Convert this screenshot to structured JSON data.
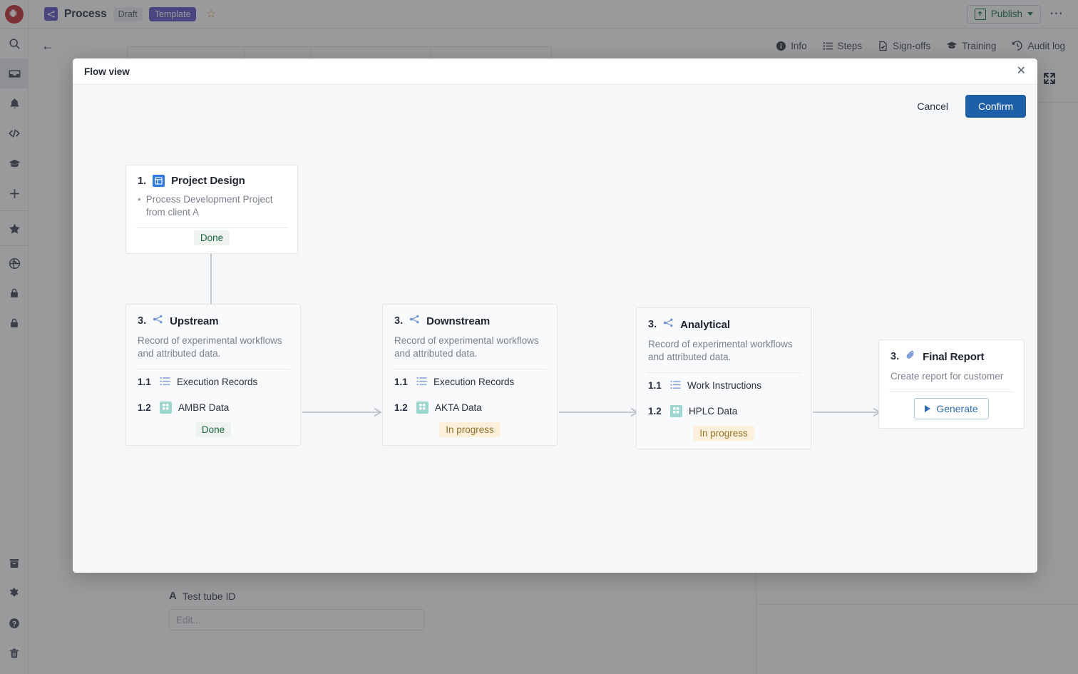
{
  "topbar": {
    "logo_icon": "lobster-logo-icon",
    "doc_type_icon": "flow-node-icon",
    "title": "Process",
    "draft_chip": "Draft",
    "template_chip": "Template",
    "star_icon": "star-outline-icon",
    "publish_label": "Publish",
    "publish_icon": "publish-upload-icon",
    "publish_caret_icon": "chevron-down-icon",
    "more_icon": "ellipsis-icon",
    "publish_color": "#0b6b3a",
    "template_chip_color": "#5b4bc4"
  },
  "rail": {
    "items": [
      {
        "icon": "search-icon",
        "active": false
      },
      {
        "icon": "inbox-icon",
        "active": true
      },
      {
        "icon": "bell-icon",
        "active": false
      },
      {
        "icon": "code-icon",
        "active": false
      },
      {
        "icon": "graduation-cap-icon",
        "active": false
      },
      {
        "icon": "plus-icon",
        "active": false
      },
      {
        "icon": "star-icon",
        "active": false
      },
      {
        "icon": "globe-icon",
        "active": false
      },
      {
        "icon": "lock-icon",
        "active": false
      },
      {
        "icon": "lock-closed-icon",
        "active": false
      }
    ],
    "bottom_items": [
      {
        "icon": "archive-icon"
      },
      {
        "icon": "gear-icon"
      },
      {
        "icon": "help-circle-icon"
      },
      {
        "icon": "trash-icon"
      }
    ]
  },
  "subheader": {
    "back_icon": "back-arrow-icon",
    "tabs": [
      {
        "icon": "info-icon",
        "label": "Info"
      },
      {
        "icon": "steps-list-icon",
        "label": "Steps"
      },
      {
        "icon": "sign-offs-doc-icon",
        "label": "Sign-offs"
      },
      {
        "icon": "training-cap-icon",
        "label": "Training"
      },
      {
        "icon": "audit-log-clock-icon",
        "label": "Audit log"
      }
    ]
  },
  "background_field": {
    "glyph": "A",
    "label": "Test tube ID",
    "input_placeholder": "Edit..."
  },
  "modal": {
    "title": "Flow view",
    "close_icon": "close-icon",
    "expand_icon": "expand-fullscreen-icon",
    "cancel_label": "Cancel",
    "confirm_label": "Confirm",
    "confirm_color": "#1d5fa8"
  },
  "flow": {
    "cards": [
      {
        "id": "project-design",
        "num": "1.",
        "icon": "layout-panel-icon",
        "icon_style": "blue-box",
        "title": "Project Design",
        "desc": "Process Development Project from client A",
        "desc_style": "bullet",
        "subitems": [],
        "badge": {
          "label": "Done",
          "style": "done"
        }
      },
      {
        "id": "upstream",
        "num": "3.",
        "icon": "flow-node-icon",
        "icon_style": "plain-blue",
        "title": "Upstream",
        "desc": "Record of experimental workflows and attributed data.",
        "desc_style": "plain",
        "subitems": [
          {
            "num": "1.1",
            "icon": "list-checklist-icon",
            "icon_style": "plain-blue",
            "label": "Execution Records"
          },
          {
            "num": "1.2",
            "icon": "table-grid-icon",
            "icon_style": "teal-box",
            "label": "AMBR Data"
          }
        ],
        "badge": {
          "label": "Done",
          "style": "done"
        }
      },
      {
        "id": "downstream",
        "num": "3.",
        "icon": "flow-node-icon",
        "icon_style": "plain-blue",
        "title": "Downstream",
        "desc": "Record of experimental workflows and attributed data.",
        "desc_style": "plain",
        "subitems": [
          {
            "num": "1.1",
            "icon": "list-checklist-icon",
            "icon_style": "plain-blue",
            "label": "Execution Records"
          },
          {
            "num": "1.2",
            "icon": "table-grid-icon",
            "icon_style": "teal-box",
            "label": "AKTA Data"
          }
        ],
        "badge": {
          "label": "In progress",
          "style": "progress"
        }
      },
      {
        "id": "analytical",
        "num": "3.",
        "icon": "flow-node-icon",
        "icon_style": "plain-blue",
        "title": "Analytical",
        "desc": "Record of experimental workflows and attributed data.",
        "desc_style": "plain",
        "subitems": [
          {
            "num": "1.1",
            "icon": "list-checklist-icon",
            "icon_style": "plain-blue",
            "label": "Work Instructions"
          },
          {
            "num": "1.2",
            "icon": "table-grid-icon",
            "icon_style": "teal-box",
            "label": "HPLC Data"
          }
        ],
        "badge": {
          "label": "In progress",
          "style": "progress"
        }
      },
      {
        "id": "final-report",
        "num": "3.",
        "icon": "paperclip-icon",
        "icon_style": "plain-blue",
        "title": "Final Report",
        "desc": "Create report for customer",
        "desc_style": "plain",
        "subitems": [],
        "action_button": {
          "label": "Generate",
          "icon": "play-icon"
        }
      }
    ]
  }
}
